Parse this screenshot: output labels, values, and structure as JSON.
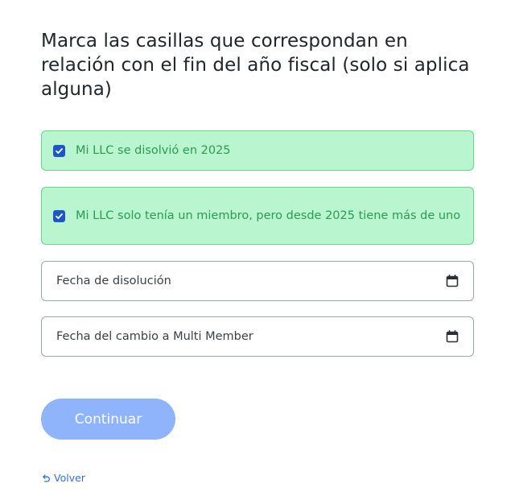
{
  "form": {
    "title": "Marca las casillas que correspondan en relación con el fin del año fiscal (solo si aplica alguna)",
    "options": [
      {
        "label": "Mi LLC se disolvió en 2025",
        "checked": true
      },
      {
        "label": "Mi LLC solo tenía un miembro, pero desde 2025 tiene más de uno",
        "checked": true
      }
    ],
    "dissolution_date": {
      "placeholder": "Fecha de disolución",
      "value": ""
    },
    "multi_member_date": {
      "placeholder": "Fecha del cambio a Multi Member",
      "value": ""
    },
    "continue_label": "Continuar",
    "back_label": "Volver"
  },
  "icons": {
    "checkbox": "checkmark-icon",
    "date_picker": "calendar-icon",
    "back": "undo-arrow-icon"
  },
  "colors": {
    "option_background": "#b9f5cf",
    "option_border": "#63d98a",
    "option_text": "#2c9a53",
    "checkbox": "#1e55c8",
    "button_disabled": "#8fb4fb",
    "link": "#2f6fe6"
  }
}
